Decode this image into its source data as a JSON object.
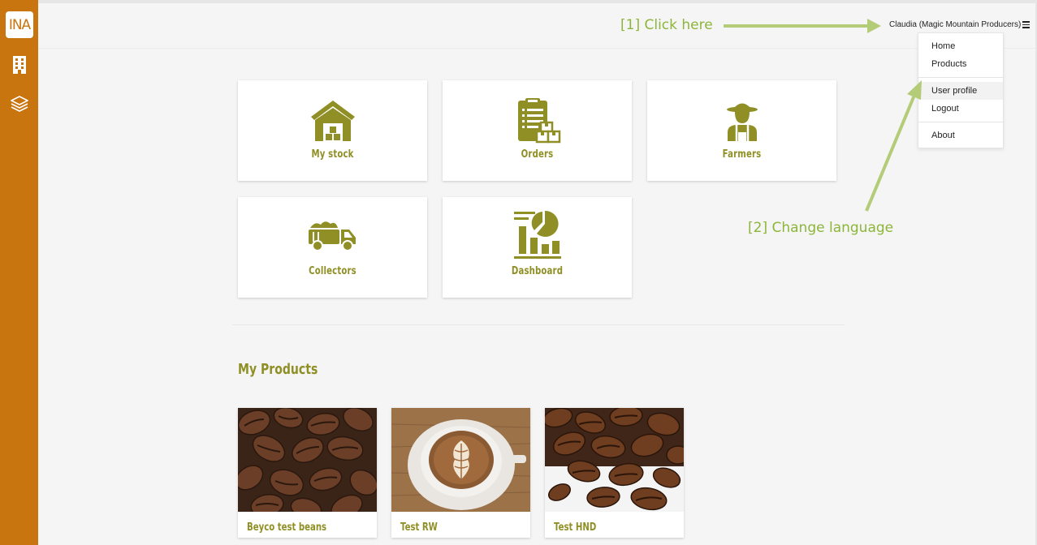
{
  "app": {
    "logo_text": "INA"
  },
  "sidebar": {
    "items": [
      {
        "icon": "building-icon"
      },
      {
        "icon": "layers-icon"
      }
    ]
  },
  "header": {
    "user_label": "Claudia (Magic Mountain Producers)",
    "menu_icon": "hamburger-icon"
  },
  "menu": {
    "items": [
      {
        "label": "Home"
      },
      {
        "label": "Products"
      },
      {
        "label": "User profile"
      },
      {
        "label": "Logout"
      },
      {
        "label": "About"
      }
    ]
  },
  "annotations": {
    "step1": "[1] Click here",
    "step2": "[2] Change language",
    "color": "#8db53a"
  },
  "tiles": [
    {
      "label": "My stock",
      "icon": "warehouse-icon"
    },
    {
      "label": "Orders",
      "icon": "clipboard-boxes-icon"
    },
    {
      "label": "Farmers",
      "icon": "farmer-icon"
    },
    {
      "label": "Collectors",
      "icon": "truck-icon"
    },
    {
      "label": "Dashboard",
      "icon": "chart-icon"
    }
  ],
  "products_section": {
    "title": "My Products"
  },
  "products": [
    {
      "name": "Beyco test beans",
      "image": "coffee-beans"
    },
    {
      "name": "Test RW",
      "image": "latte-cup"
    },
    {
      "name": "Test HND",
      "image": "coffee-beans-white"
    }
  ],
  "colors": {
    "sidebar": "#c8750f",
    "accent": "#8f8f26",
    "annotation": "#8db53a",
    "background": "#f5f5f5"
  }
}
